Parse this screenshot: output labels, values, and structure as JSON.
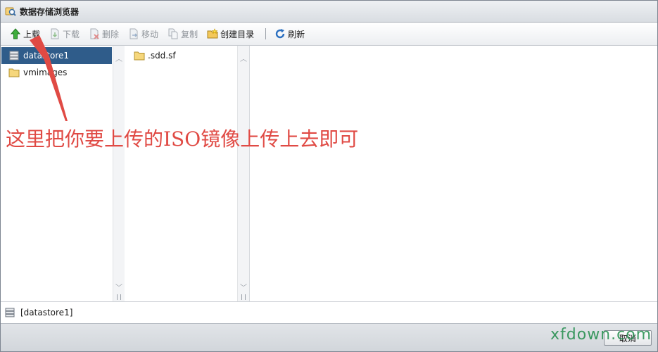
{
  "window": {
    "title": "数据存储浏览器"
  },
  "toolbar": {
    "upload": "上载",
    "download": "下载",
    "delete": "删除",
    "move": "移动",
    "copy": "复制",
    "create_dir": "创建目录",
    "refresh": "刷新"
  },
  "tree": {
    "items": [
      {
        "label": "datastore1",
        "selected": true
      },
      {
        "label": "vmimages",
        "selected": false
      }
    ]
  },
  "files": {
    "items": [
      {
        "label": ".sdd.sf"
      }
    ]
  },
  "status": {
    "path": "[datastore1]"
  },
  "footer": {
    "cancel": "取消"
  },
  "annotation": {
    "text": "这里把你要上传的ISO镜像上传上去即可"
  },
  "watermark": {
    "text": "xfdown.com"
  },
  "colors": {
    "selection": "#2f5c8a",
    "annotation": "#e04a44",
    "watermark": "#1f8c4a"
  }
}
